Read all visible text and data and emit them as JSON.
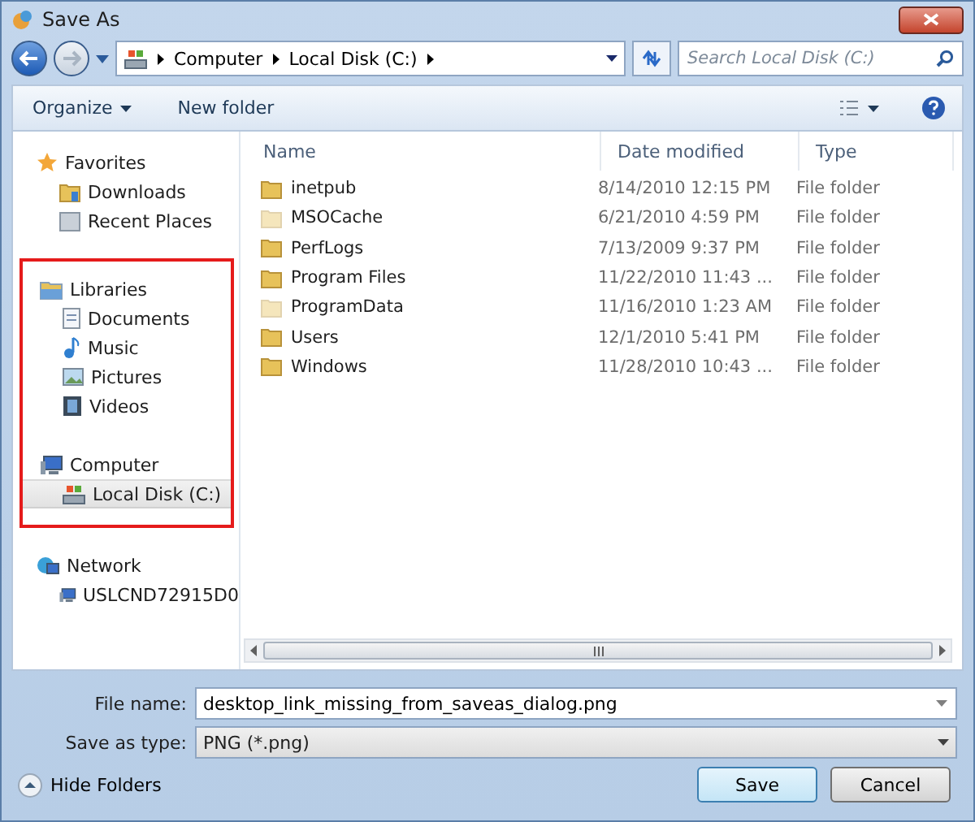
{
  "window": {
    "title": "Save As"
  },
  "address": {
    "crumbs": [
      "Computer",
      "Local Disk (C:)"
    ],
    "search_placeholder": "Search Local Disk (C:)"
  },
  "toolbar": {
    "organize": "Organize",
    "new_folder": "New folder"
  },
  "sidebar": {
    "groups": [
      {
        "label": "Favorites",
        "highlighted": false,
        "items": [
          {
            "label": "Downloads",
            "selected": false
          },
          {
            "label": "Recent Places",
            "selected": false
          }
        ]
      },
      {
        "label": "Libraries",
        "highlighted": true,
        "items": [
          {
            "label": "Documents",
            "selected": false
          },
          {
            "label": "Music",
            "selected": false
          },
          {
            "label": "Pictures",
            "selected": false
          },
          {
            "label": "Videos",
            "selected": false
          }
        ]
      },
      {
        "label": "Computer",
        "highlighted": true,
        "items": [
          {
            "label": "Local Disk (C:)",
            "selected": true
          }
        ]
      },
      {
        "label": "Network",
        "highlighted": false,
        "items": [
          {
            "label": "USLCND72915D0",
            "selected": false
          }
        ]
      }
    ]
  },
  "table": {
    "columns": [
      "Name",
      "Date modified",
      "Type"
    ],
    "rows": [
      {
        "name": "inetpub",
        "date": "8/14/2010 12:15 PM",
        "type": "File folder",
        "hidden": false
      },
      {
        "name": "MSOCache",
        "date": "6/21/2010 4:59 PM",
        "type": "File folder",
        "hidden": true
      },
      {
        "name": "PerfLogs",
        "date": "7/13/2009 9:37 PM",
        "type": "File folder",
        "hidden": false
      },
      {
        "name": "Program Files",
        "date": "11/22/2010 11:43 ...",
        "type": "File folder",
        "hidden": false
      },
      {
        "name": "ProgramData",
        "date": "11/16/2010 1:23 AM",
        "type": "File folder",
        "hidden": true
      },
      {
        "name": "Users",
        "date": "12/1/2010 5:41 PM",
        "type": "File folder",
        "hidden": false
      },
      {
        "name": "Windows",
        "date": "11/28/2010 10:43 ...",
        "type": "File folder",
        "hidden": false
      }
    ]
  },
  "form": {
    "file_name_label": "File name:",
    "file_name": "desktop_link_missing_from_saveas_dialog.png",
    "type_label": "Save as type:",
    "type_value": "PNG (*.png)"
  },
  "footer": {
    "hide_folders": "Hide Folders",
    "save": "Save",
    "cancel": "Cancel"
  }
}
